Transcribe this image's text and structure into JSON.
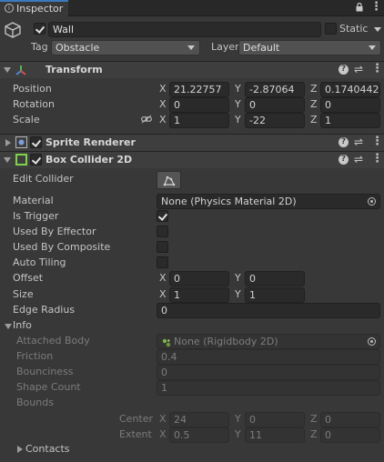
{
  "tab": {
    "title": "Inspector"
  },
  "object": {
    "active": true,
    "name": "Wall",
    "static_label": "Static",
    "static_checked": false,
    "tag_label": "Tag",
    "tag_value": "Obstacle",
    "layer_label": "Layer",
    "layer_value": "Default"
  },
  "transform": {
    "title": "Transform",
    "position": {
      "label": "Position",
      "x": "21.22757",
      "y": "-2.87064",
      "z": "0.1740442"
    },
    "rotation": {
      "label": "Rotation",
      "x": "0",
      "y": "0",
      "z": "0"
    },
    "scale": {
      "label": "Scale",
      "x": "1",
      "y": "-22",
      "z": "1"
    }
  },
  "axes": {
    "x": "X",
    "y": "Y",
    "z": "Z"
  },
  "sprite_renderer": {
    "title": "Sprite Renderer",
    "enabled": true
  },
  "box_collider": {
    "title": "Box Collider 2D",
    "enabled": true,
    "edit_collider_label": "Edit Collider",
    "material_label": "Material",
    "material_value": "None (Physics Material 2D)",
    "is_trigger_label": "Is Trigger",
    "is_trigger": true,
    "used_by_effector_label": "Used By Effector",
    "used_by_composite_label": "Used By Composite",
    "auto_tiling_label": "Auto Tiling",
    "offset": {
      "label": "Offset",
      "x": "0",
      "y": "0"
    },
    "size": {
      "label": "Size",
      "x": "1",
      "y": "1"
    },
    "edge_radius": {
      "label": "Edge Radius",
      "value": "0"
    },
    "info": {
      "label": "Info",
      "attached_body_label": "Attached Body",
      "attached_body_value": "None (Rigidbody 2D)",
      "friction_label": "Friction",
      "friction_value": "0.4",
      "bounciness_label": "Bounciness",
      "bounciness_value": "0",
      "shape_count_label": "Shape Count",
      "shape_count_value": "1",
      "bounds_label": "Bounds",
      "center_label": "Center",
      "center": {
        "x": "24",
        "y": "0",
        "z": "0"
      },
      "extent_label": "Extent",
      "extent": {
        "x": "0.5",
        "y": "11",
        "z": "0"
      },
      "contacts_label": "Contacts"
    }
  },
  "icons": {
    "lock": "lock-icon",
    "menu": "kebab-menu-icon",
    "help": "help-icon",
    "presets": "presets-icon"
  }
}
